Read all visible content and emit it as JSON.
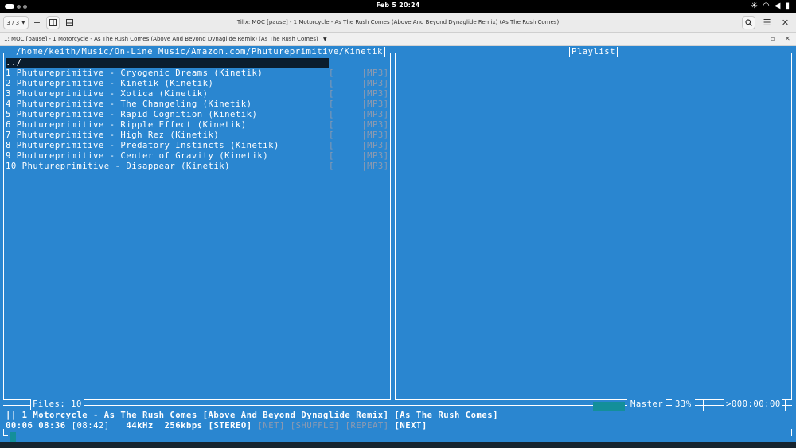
{
  "topbar": {
    "clock": "Feb 5  20:24",
    "tray_icons": [
      "brightness-icon",
      "wifi-icon",
      "volume-icon",
      "battery-icon"
    ]
  },
  "header": {
    "session_label": "3 / 3",
    "window_title": "Tilix: MOC [pause] - 1 Motorcycle - As The Rush Comes (Above And Beyond Dynaglide Remix) (As The Rush Comes)"
  },
  "terminal_title": "1: MOC [pause] - 1 Motorcycle - As The Rush Comes (Above And Beyond Dynaglide Remix) (As The Rush Comes)",
  "browser": {
    "path": "/home/keith/Music/On-Line_Music/Amazon.com/Phutureprimitive/Kinetik",
    "parent_entry": "../",
    "files": [
      {
        "name": "1 Phutureprimitive - Cryogenic Dreams (Kinetik)",
        "format": "[     |MP3]"
      },
      {
        "name": "2 Phutureprimitive - Kinetik (Kinetik)",
        "format": "[     |MP3]"
      },
      {
        "name": "3 Phutureprimitive - Xotica (Kinetik)",
        "format": "[     |MP3]"
      },
      {
        "name": "4 Phutureprimitive - The Changeling (Kinetik)",
        "format": "[     |MP3]"
      },
      {
        "name": "5 Phutureprimitive - Rapid Cognition (Kinetik)",
        "format": "[     |MP3]"
      },
      {
        "name": "6 Phutureprimitive - Ripple Effect (Kinetik)",
        "format": "[     |MP3]"
      },
      {
        "name": "7 Phutureprimitive - High Rez (Kinetik)",
        "format": "[     |MP3]"
      },
      {
        "name": "8 Phutureprimitive - Predatory Instincts (Kinetik)",
        "format": "[     |MP3]"
      },
      {
        "name": "9 Phutureprimitive - Center of Gravity (Kinetik)",
        "format": "[     |MP3]"
      },
      {
        "name": "10 Phutureprimitive - Disappear (Kinetik)",
        "format": "[     |MP3]"
      }
    ]
  },
  "playlist": {
    "title": "Playlist"
  },
  "status": {
    "files_count": "Files: 10",
    "mixer_label": "Master",
    "volume": "33%",
    "volume_fraction": 0.33,
    "timer": ">000:00:00",
    "now_playing": "|| 1 Motorcycle - As The Rush Comes [Above And Beyond Dynaglide Remix] [As The Rush Comes]",
    "position": "00:06",
    "time_left": "08:36",
    "total": "[08:42]",
    "rate": "44kHz",
    "bitrate": "256kbps",
    "stereo": "[STEREO]",
    "net": "[NET]",
    "shuffle": "[SHUFFLE]",
    "repeat": "[REPEAT]",
    "next": "[NEXT]"
  },
  "colors": {
    "terminal_bg": "#2a86d0",
    "highlight": "#138f9a",
    "selected_row": "#0a1d2e"
  }
}
